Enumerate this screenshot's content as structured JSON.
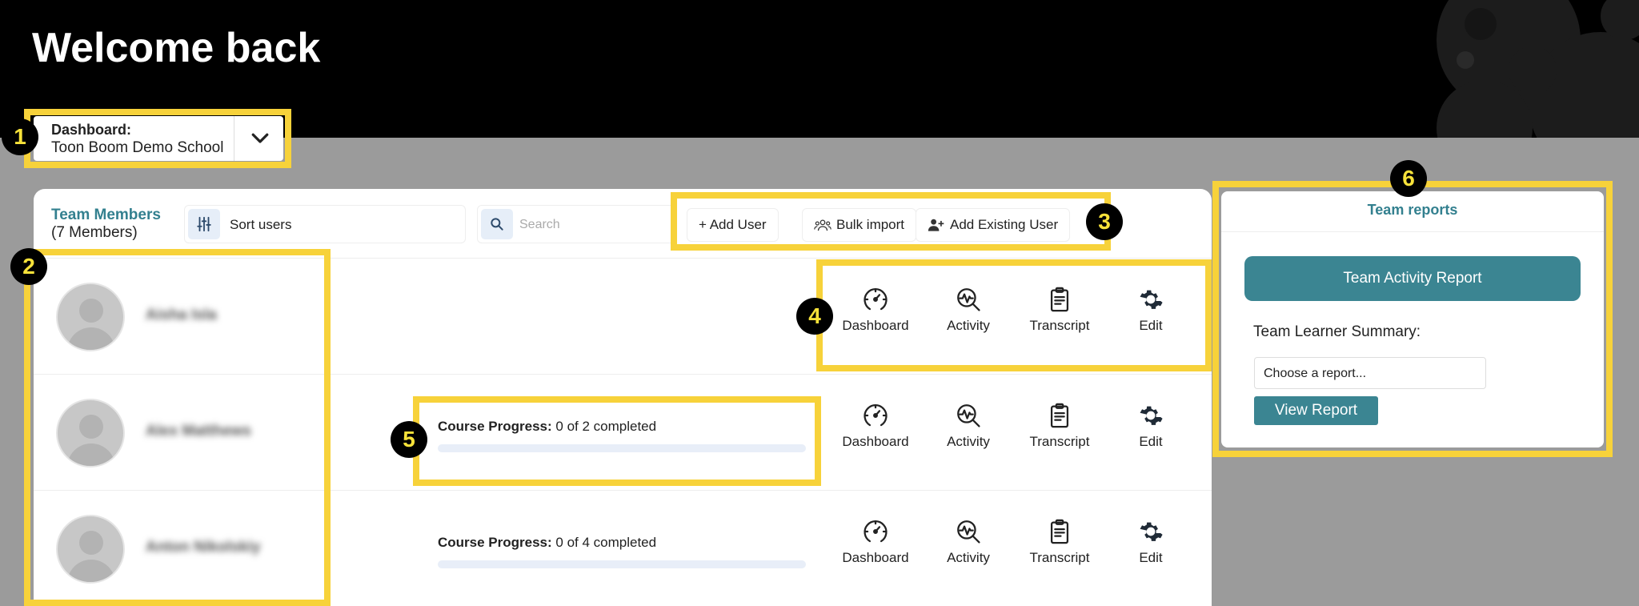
{
  "header": {
    "title": "Welcome back"
  },
  "dashboard_select": {
    "label": "Dashboard:",
    "value": "Toon Boom Demo School"
  },
  "team": {
    "title": "Team Members",
    "count": "(7 Members)"
  },
  "toolbar": {
    "sort_label": "Sort users",
    "search_placeholder": "Search",
    "add_user": "+ Add User",
    "bulk_import": "Bulk import",
    "add_existing": "Add Existing User"
  },
  "actions": {
    "dashboard": "Dashboard",
    "activity": "Activity",
    "transcript": "Transcript",
    "edit": "Edit"
  },
  "rows": [
    {
      "name": "Aisha Isla",
      "progress_label": "",
      "progress_text": "",
      "progress_fraction": 0
    },
    {
      "name": "Alex Matthews",
      "progress_label": "Course Progress:",
      "progress_text": " 0 of 2 completed",
      "progress_fraction": 0
    },
    {
      "name": "Anton Nikolskiy",
      "progress_label": "Course Progress:",
      "progress_text": " 0 of 4 completed",
      "progress_fraction": 0
    }
  ],
  "reports": {
    "title": "Team reports",
    "activity_button": "Team Activity Report",
    "summary_label": "Team Learner Summary:",
    "select_value": "Choose a report...",
    "view_button": "View Report"
  },
  "callouts": [
    "1",
    "2",
    "3",
    "4",
    "5",
    "6"
  ],
  "colors": {
    "accent": "#33808f",
    "highlight": "#f7d23a",
    "badge_text": "#f7e23a"
  }
}
